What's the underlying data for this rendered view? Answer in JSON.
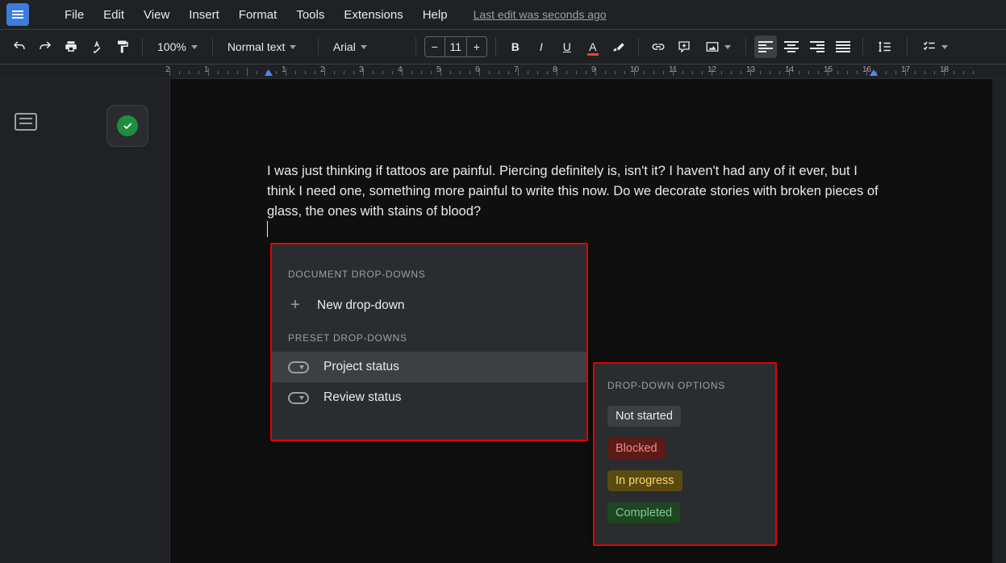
{
  "menu": {
    "items": [
      "File",
      "Edit",
      "View",
      "Insert",
      "Format",
      "Tools",
      "Extensions",
      "Help"
    ],
    "last_edit": "Last edit was seconds ago"
  },
  "toolbar": {
    "zoom": "100%",
    "style": "Normal text",
    "font": "Arial",
    "font_size": "11"
  },
  "ruler": {
    "marks": [
      "2",
      "1",
      "",
      "1",
      "2",
      "3",
      "4",
      "5",
      "6",
      "7",
      "8",
      "9",
      "10",
      "11",
      "12",
      "13",
      "14",
      "15",
      "16",
      "17",
      "18"
    ]
  },
  "document": {
    "body_text": "I was just thinking if tattoos are painful. Piercing definitely is, isn't it? I haven't had any of it ever, but I think I need one, something more painful to write this now. Do we decorate stories with broken pieces of glass, the ones with stains of blood?"
  },
  "dropdown_panel": {
    "section1_label": "Document drop-downs",
    "new_item": "New drop-down",
    "section2_label": "Preset drop-downs",
    "presets": [
      "Project status",
      "Review status"
    ]
  },
  "options_panel": {
    "label": "Drop-down options",
    "options": [
      {
        "text": "Not started",
        "class": "notstarted"
      },
      {
        "text": "Blocked",
        "class": "blocked"
      },
      {
        "text": "In progress",
        "class": "inprogress"
      },
      {
        "text": "Completed",
        "class": "completed"
      }
    ]
  }
}
